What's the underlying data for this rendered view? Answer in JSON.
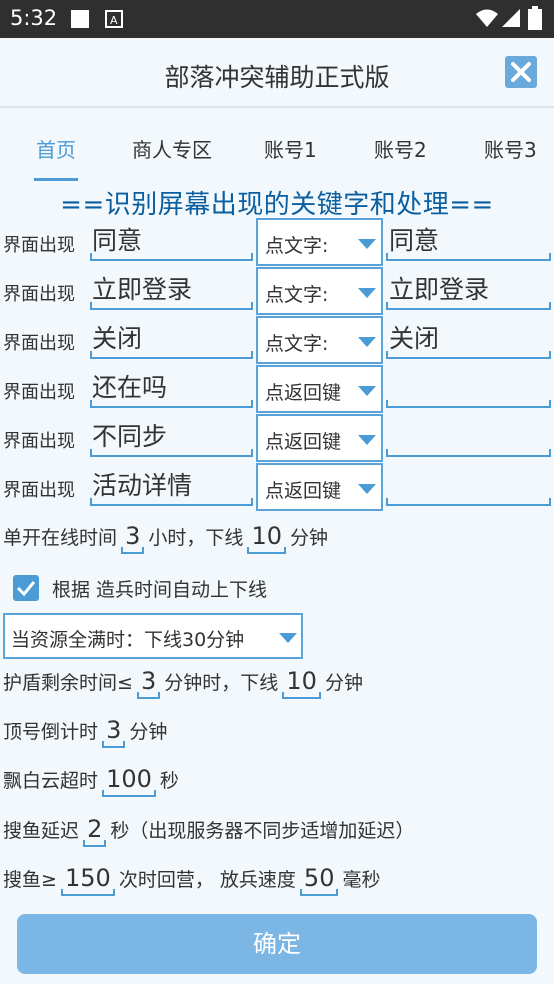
{
  "status_bar": {
    "time": "5:32"
  },
  "header": {
    "title": "部落冲突辅助正式版"
  },
  "tabs": [
    {
      "label": "首页"
    },
    {
      "label": "商人专区"
    },
    {
      "label": "账号1"
    },
    {
      "label": "账号2"
    },
    {
      "label": "账号3"
    }
  ],
  "section_title": "==识别屏幕出现的关键字和处理==",
  "rows": [
    {
      "label": "界面出现",
      "keyword": "同意",
      "action": "点文字:",
      "param": "同意"
    },
    {
      "label": "界面出现",
      "keyword": "立即登录",
      "action": "点文字:",
      "param": "立即登录"
    },
    {
      "label": "界面出现",
      "keyword": "关闭",
      "action": "点文字:",
      "param": "关闭"
    },
    {
      "label": "界面出现",
      "keyword": "还在吗",
      "action": "点返回键",
      "param": ""
    },
    {
      "label": "界面出现",
      "keyword": "不同步",
      "action": "点返回键",
      "param": ""
    },
    {
      "label": "界面出现",
      "keyword": "活动详情",
      "action": "点返回键",
      "param": ""
    }
  ],
  "online_time": {
    "prefix": "单开在线时间",
    "hours": "3",
    "mid": "小时，下线",
    "minutes": "10",
    "suffix": "分钟"
  },
  "auto_offline": {
    "label": "根据 造兵时间自动上下线",
    "checked": true
  },
  "resource_full": {
    "selected": "当资源全满时：下线30分钟"
  },
  "shield": {
    "prefix": "护盾剩余时间≤",
    "value": "3",
    "mid": "分钟时，下线",
    "minutes": "10",
    "suffix": "分钟"
  },
  "countdown": {
    "prefix": "顶号倒计时",
    "value": "3",
    "suffix": "分钟"
  },
  "cloud": {
    "prefix": "飘白云超时",
    "value": "100",
    "suffix": "秒"
  },
  "search_delay": {
    "prefix": "搜鱼延迟",
    "value": "2",
    "suffix": "秒（出现服务器不同步适增加延迟）"
  },
  "search_count": {
    "prefix": "搜鱼≥",
    "value": "150",
    "mid": "次时回营，  放兵速度",
    "speed": "50",
    "suffix": "毫秒"
  },
  "confirm_label": "确定",
  "colors": {
    "accent": "#4a9bd6",
    "section_title": "#0b5fa0",
    "status_bar": "#2f2f2f",
    "background": "#f2f8fc"
  }
}
